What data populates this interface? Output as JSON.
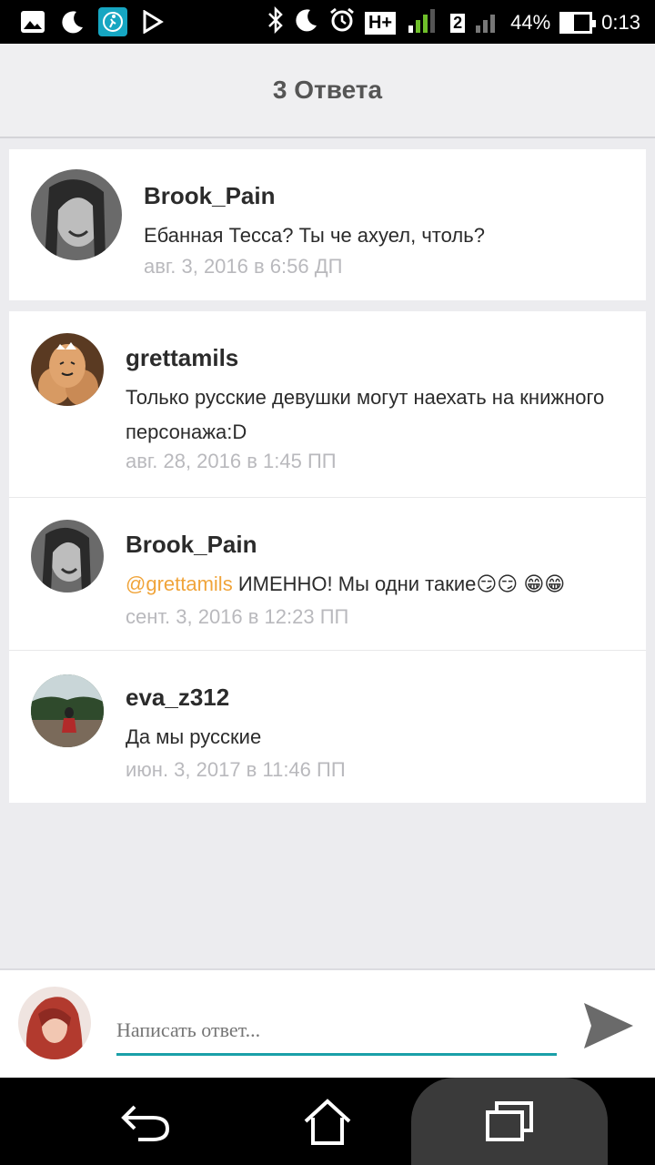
{
  "status_bar": {
    "battery_percent": "44%",
    "battery_level": 0.44,
    "time": "0:13",
    "network": "H+",
    "sim2": "2",
    "icons": [
      "gallery-icon",
      "moon-icon",
      "fitness-app-icon",
      "play-store-icon",
      "bluetooth-icon",
      "moon-icon",
      "alarm-icon",
      "signal-icon",
      "battery-icon"
    ]
  },
  "header": {
    "title": "3 Ответа"
  },
  "original_comment": {
    "username": "Brook_Pain",
    "text": "Ебанная Тесса? Ты че ахуел, чтоль?",
    "time": "авг. 3, 2016 в 6:56 ДП"
  },
  "replies": [
    {
      "username": "grettamils",
      "text": "Только русские девушки могут наехать на книжного персонажа:D",
      "time": "авг. 28, 2016 в 1:45 ПП"
    },
    {
      "username": "Brook_Pain",
      "mention": "@grettamils",
      "text": " ИМЕННО! Мы одни такие😏😏 😁😁",
      "time": "сент. 3, 2016 в 12:23 ПП"
    },
    {
      "username": "eva_z312",
      "text": "Да мы русские",
      "time": "июн. 3, 2017 в 11:46 ПП"
    }
  ],
  "reply_box": {
    "placeholder": "Написать ответ...",
    "accent_color": "#1aa0a8"
  },
  "colors": {
    "mention": "#f0a43a",
    "timestamp": "#b9b9bd",
    "background": "#ececef"
  }
}
